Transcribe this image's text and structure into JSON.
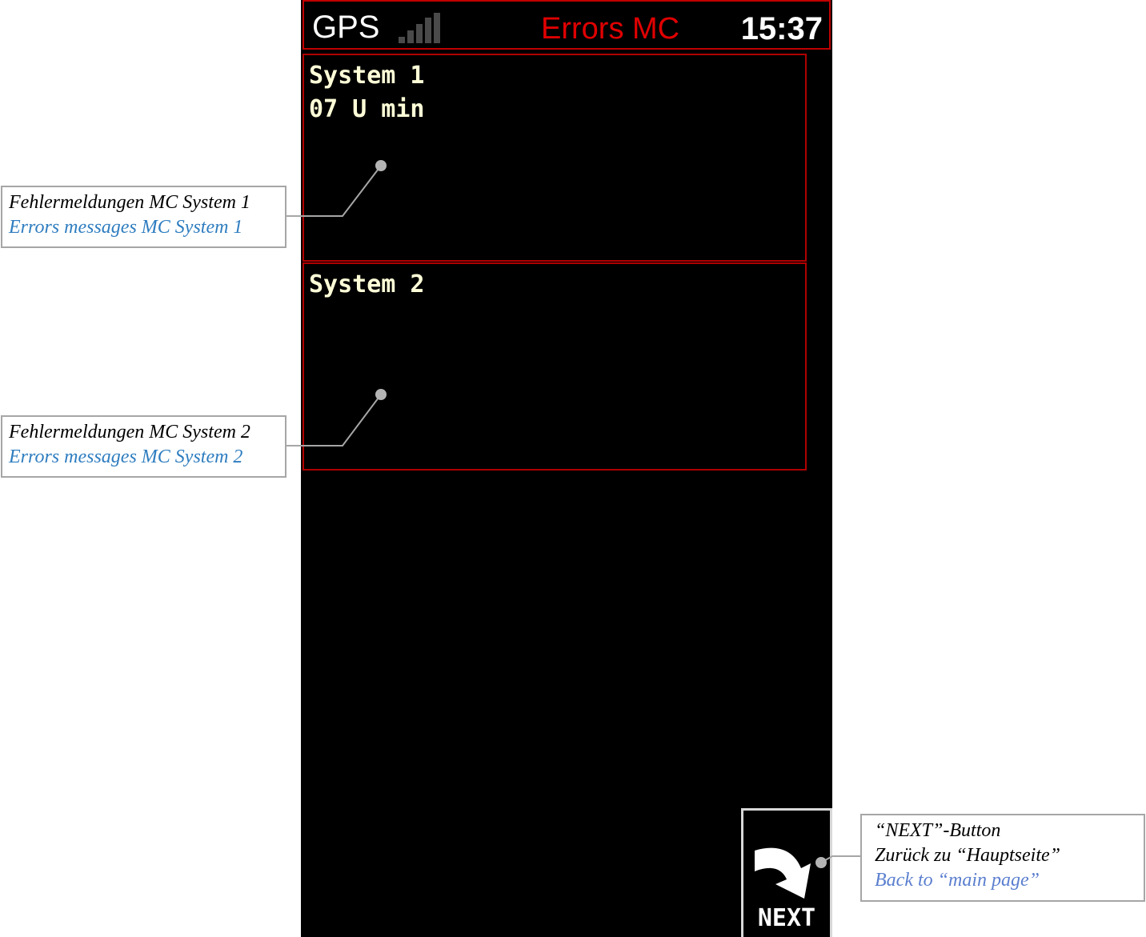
{
  "device": {
    "status_bar": {
      "gps_label": "GPS",
      "signal_strength": 0,
      "title": "Errors MC",
      "clock": "15:37"
    },
    "panels": [
      {
        "lines": [
          "System 1",
          "07 U min"
        ]
      },
      {
        "lines": [
          "System 2"
        ]
      }
    ],
    "next_button": {
      "label": "NEXT",
      "icon": "curved-arrow-down-right-icon"
    }
  },
  "callouts": [
    {
      "de": "Fehlermeldungen MC System 1",
      "en": "Errors messages MC System 1"
    },
    {
      "de": "Fehlermeldungen MC System 2",
      "en": "Errors messages MC System 2"
    },
    {
      "de_lines": [
        "“NEXT”-Button",
        "Zurück zu “Hauptseite”"
      ],
      "en": "Back to “main page”"
    }
  ],
  "colors": {
    "screen_bg": "#000000",
    "frame_red": "#c00000",
    "title_red": "#e00000",
    "panel_text": "#ffffd8",
    "callout_en_blue": "#2e7dc0"
  }
}
